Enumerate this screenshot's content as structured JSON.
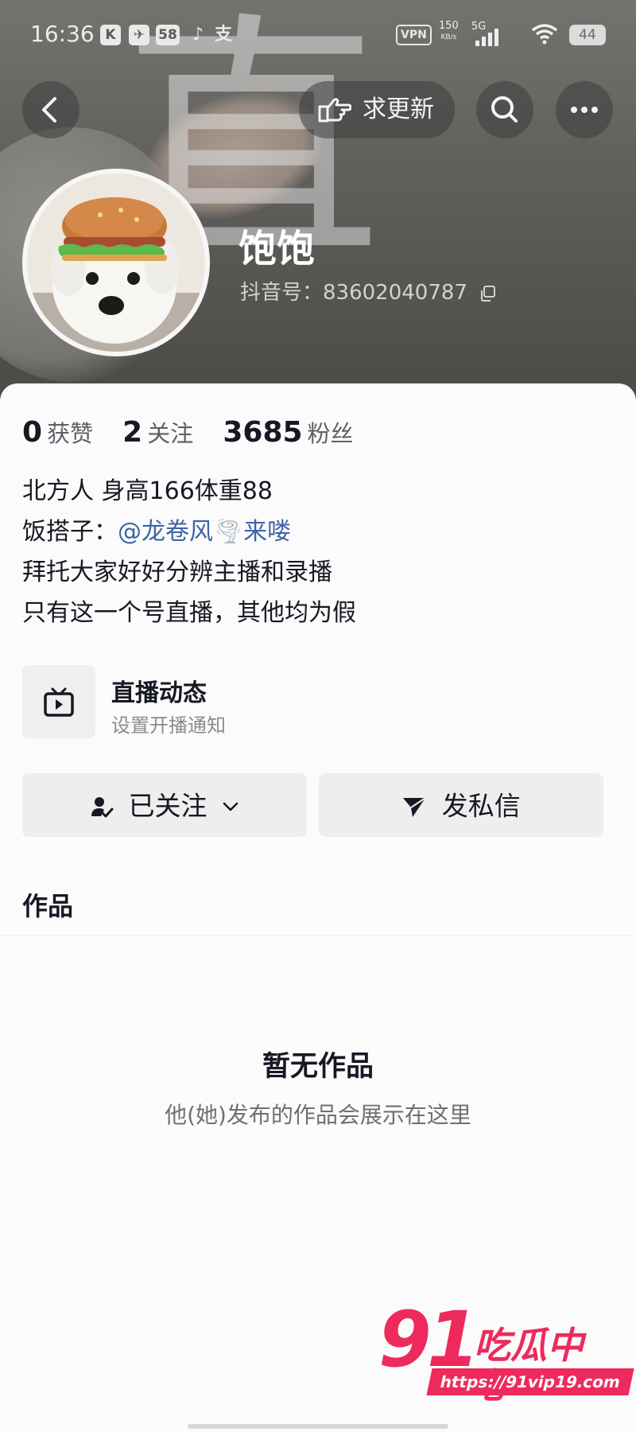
{
  "status_bar": {
    "time": "16:36",
    "app_icons": [
      "K",
      "✈",
      "58",
      "♪",
      "支"
    ],
    "vpn": "VPN",
    "speed": "150",
    "speed_unit": "KB/s",
    "network": "5G",
    "battery": "44"
  },
  "nav": {
    "update_request_label": "求更新"
  },
  "profile": {
    "nickname": "饱饱",
    "douyin_id": "抖音号：83602040787",
    "header_watermark_glyph": "直"
  },
  "stats": {
    "likes_count": "0",
    "likes_label": "获赞",
    "following_count": "2",
    "following_label": "关注",
    "followers_count": "3685",
    "followers_label": "粉丝"
  },
  "bio": {
    "line1": "北方人 身高166体重88",
    "line2_prefix": "饭搭子：",
    "line2_mention": "@龙卷风",
    "line2_emoji": "🌪",
    "line2_suffix": "来喽",
    "line3": "拜托大家好好分辨主播和录播",
    "line4": "只有这一个号直播，其他均为假"
  },
  "live_card": {
    "title": "直播动态",
    "subtitle": "设置开播通知"
  },
  "actions": {
    "follow_label": "已关注",
    "message_label": "发私信"
  },
  "tabs": {
    "works_label": "作品"
  },
  "empty_state": {
    "title": "暂无作品",
    "subtitle": "他(她)发布的作品会展示在这里"
  },
  "site_watermark": {
    "number": "91",
    "name": "吃瓜中心",
    "url": "https://91vip19.com"
  },
  "colors": {
    "mention": "#3e64a6",
    "button_bg": "#eeeeee",
    "watermark_red": "#ee2a5c"
  }
}
